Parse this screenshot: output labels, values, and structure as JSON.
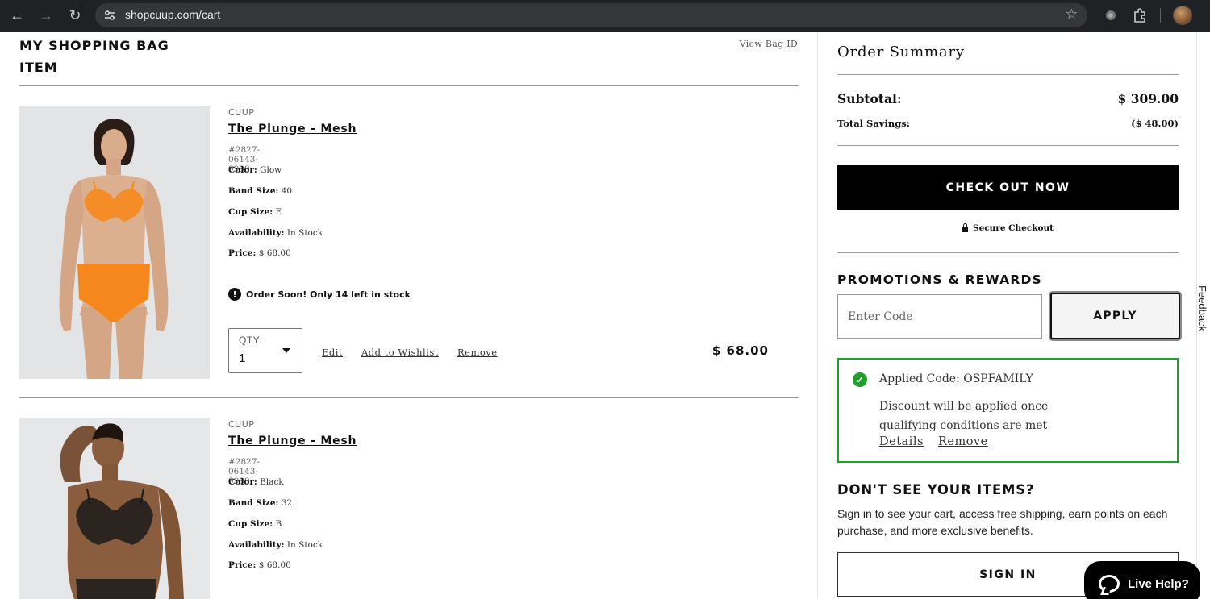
{
  "browser": {
    "url": "shopcuup.com/cart"
  },
  "cart": {
    "title_line1": "MY SHOPPING BAG",
    "title_line2": "ITEM",
    "view_bag_id": "View Bag ID",
    "items": [
      {
        "brand": "CUUP",
        "name": "The Plunge - Mesh",
        "sku": "#2827-06143-9999",
        "color_label": "Color:",
        "color": "Glow",
        "band_label": "Band Size:",
        "band": "40",
        "cup_label": "Cup Size:",
        "cup": "E",
        "availability_label": "Availability:",
        "availability": "In Stock",
        "price_label": "Price:",
        "price": "$ 68.00",
        "stock_warning": "Order Soon! Only 14 left in stock",
        "qty_label": "QTY",
        "qty": "1",
        "edit": "Edit",
        "wishlist": "Add to Wishlist",
        "remove": "Remove",
        "line_total": "$ 68.00"
      },
      {
        "brand": "CUUP",
        "name": "The Plunge - Mesh",
        "sku": "#2827-06143-9999",
        "color_label": "Color:",
        "color": "Black",
        "band_label": "Band Size:",
        "band": "32",
        "cup_label": "Cup Size:",
        "cup": "B",
        "availability_label": "Availability:",
        "availability": "In Stock",
        "price_label": "Price:",
        "price": "$ 68.00"
      }
    ]
  },
  "summary": {
    "title": "Order Summary",
    "subtotal_label": "Subtotal:",
    "subtotal": "$ 309.00",
    "savings_label": "Total Savings:",
    "savings": "($ 48.00)",
    "checkout": "CHECK OUT NOW",
    "secure": "Secure Checkout",
    "promo_title": "PROMOTIONS & REWARDS",
    "code_placeholder": "Enter Code",
    "apply": "APPLY",
    "applied_code": "Applied Code: OSPFAMILY",
    "applied_note": "Discount will be applied once qualifying conditions are met",
    "details": "Details",
    "remove": "Remove",
    "dsy_title": "DON'T SEE YOUR ITEMS?",
    "dsy_text": "Sign in to see your cart, access free shipping, earn points on each purchase, and more exclusive benefits.",
    "signin": "SIGN IN"
  },
  "widgets": {
    "feedback": "Feedback",
    "live_help": "Live Help?"
  },
  "colors": {
    "chrome_bg": "#202124",
    "accent_green": "#1fa02b",
    "bra_glow": "#f58a1f",
    "bra_black": "#1a1a1a"
  }
}
